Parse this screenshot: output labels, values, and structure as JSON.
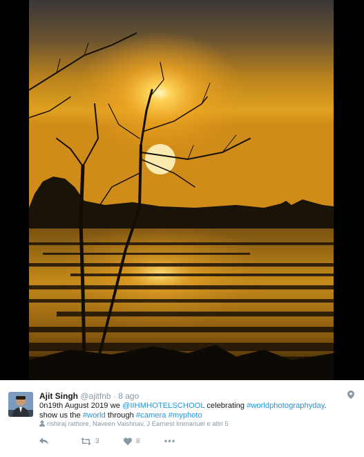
{
  "tweet": {
    "author_name": "Ajit Singh",
    "handle": "@ajitfnb",
    "separator": "·",
    "time": "8 ago",
    "text": {
      "part1": "0n19th August 2019 we ",
      "mention": "@IIHMHOTELSCHOOL",
      "part2": " celebrating ",
      "hashtag1": "#worldphotographyday",
      "part3": ". show us the ",
      "hashtag2": "#world",
      "part4": " through ",
      "hashtag3": "#camera",
      "part5": " ",
      "hashtag4": "#myphoto"
    },
    "tagged": "rishiraj rathore, Naveen Vaishnav, J Earnest Immanuel e altri 5",
    "actions": {
      "retweet_count": "3",
      "like_count": "8"
    }
  },
  "colors": {
    "link": "#1b95e0",
    "muted": "#8899a6",
    "text": "#14171a"
  },
  "icons": {
    "reply": "reply-icon",
    "retweet": "retweet-icon",
    "like": "heart-icon",
    "more": "more-icon",
    "location": "location-pin-icon",
    "tag": "person-tag-icon"
  }
}
